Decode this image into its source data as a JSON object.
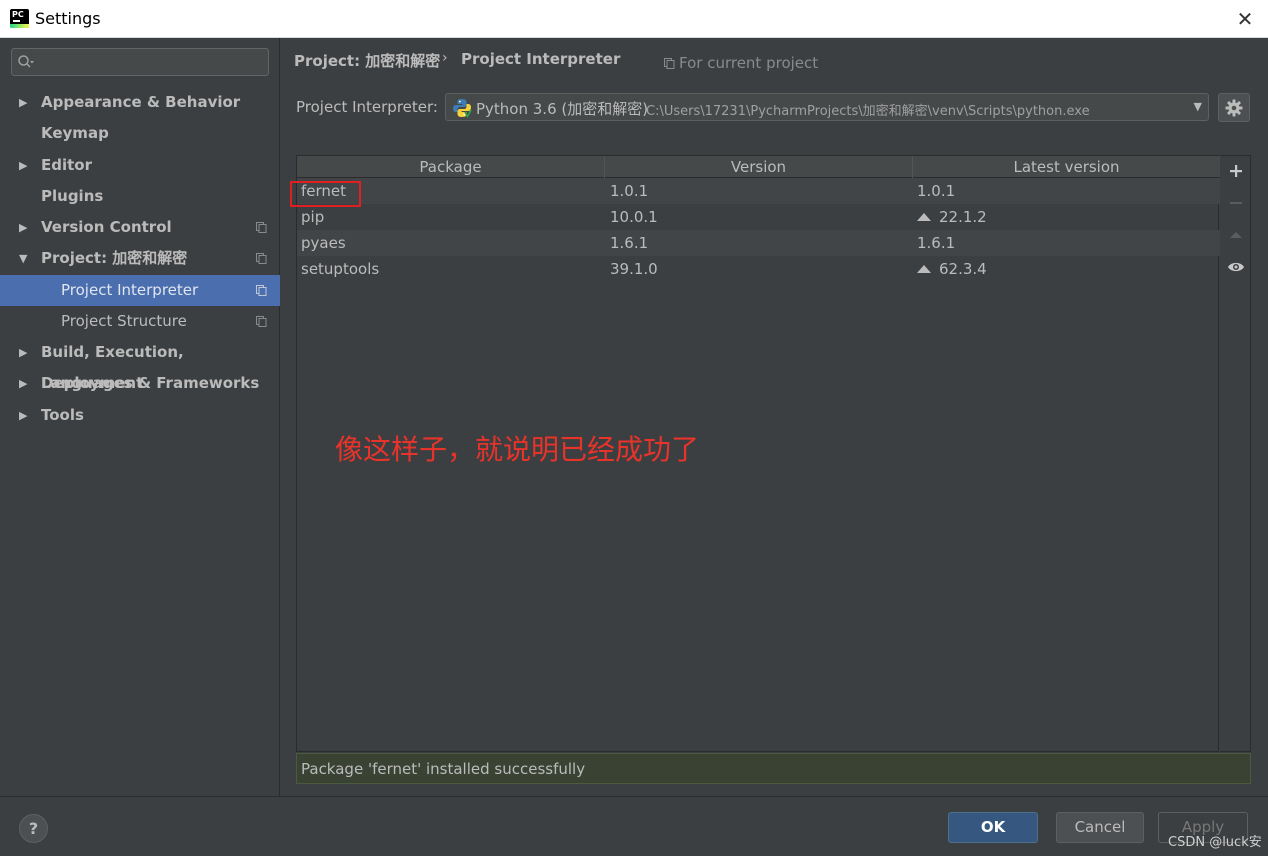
{
  "window": {
    "title": "Settings",
    "app_icon_text": "PC"
  },
  "sidebar": {
    "search": {
      "placeholder": "",
      "value": ""
    },
    "items": [
      {
        "label": "Appearance & Behavior",
        "expandable": true,
        "expanded": false
      },
      {
        "label": "Keymap",
        "expandable": false
      },
      {
        "label": "Editor",
        "expandable": true,
        "expanded": false
      },
      {
        "label": "Plugins",
        "expandable": false
      },
      {
        "label": "Version Control",
        "expandable": true,
        "expanded": false,
        "project_scope": true
      },
      {
        "label": "Project: 加密和解密",
        "expandable": true,
        "expanded": true,
        "project_scope": true
      },
      {
        "label": "Project Interpreter",
        "sub": true,
        "selected": true,
        "project_scope": true
      },
      {
        "label": "Project Structure",
        "sub": true,
        "project_scope": true
      },
      {
        "label": "Build, Execution, Deployment",
        "expandable": true,
        "expanded": false
      },
      {
        "label": "Languages & Frameworks",
        "expandable": true,
        "expanded": false
      },
      {
        "label": "Tools",
        "expandable": true,
        "expanded": false
      }
    ]
  },
  "breadcrumb": {
    "parent": "Project: 加密和解密",
    "separator": "›",
    "current": "Project Interpreter",
    "scope_note": "For current project"
  },
  "interpreter": {
    "label": "Project Interpreter:",
    "name": "Python 3.6 (加密和解密)",
    "path": "C:\\Users\\17231\\PycharmProjects\\加密和解密\\venv\\Scripts\\python.exe"
  },
  "packages_table": {
    "columns": [
      "Package",
      "Version",
      "Latest version"
    ],
    "rows": [
      {
        "package": "fernet",
        "version": "1.0.1",
        "latest": "1.0.1",
        "upgrade": false
      },
      {
        "package": "pip",
        "version": "10.0.1",
        "latest": "22.1.2",
        "upgrade": true
      },
      {
        "package": "pyaes",
        "version": "1.6.1",
        "latest": "1.6.1",
        "upgrade": false
      },
      {
        "package": "setuptools",
        "version": "39.1.0",
        "latest": "62.3.4",
        "upgrade": true
      }
    ]
  },
  "annotation": "像这样子，就说明已经成功了",
  "status_message": "Package 'fernet' installed successfully",
  "buttons": {
    "ok": "OK",
    "cancel": "Cancel",
    "apply": "Apply",
    "help": "?"
  },
  "watermark": "CSDN @luck安",
  "colors": {
    "selection": "#4b6eaf",
    "annotation": "#e8332a",
    "highlight_box": "#e02020",
    "ok_button": "#365880"
  }
}
